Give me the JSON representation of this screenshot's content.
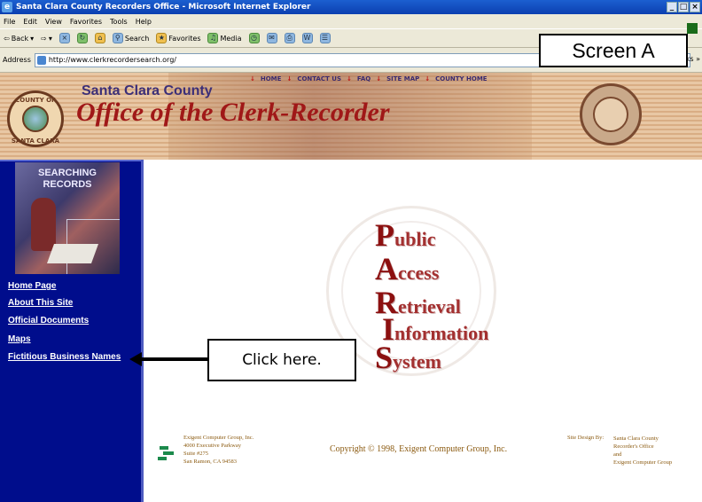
{
  "window": {
    "title": "Santa Clara County Recorders Office - Microsoft Internet Explorer",
    "controls": [
      "_",
      "□",
      "×"
    ]
  },
  "menubar": [
    "File",
    "Edit",
    "View",
    "Favorites",
    "Tools",
    "Help"
  ],
  "toolbar": {
    "back": "Back",
    "search": "Search",
    "favorites": "Favorites",
    "media": "Media"
  },
  "addressbar": {
    "label": "Address",
    "url": "http://www.clerkrecordersearch.org/",
    "links_stub": "ks »"
  },
  "annotations": {
    "screen_label": "Screen A",
    "click_here": "Click here."
  },
  "banner": {
    "county": "Santa Clara County",
    "office": "Office of the Clerk-Recorder",
    "seal_top": "COUNTY OF",
    "seal_bottom": "SANTA CLARA",
    "topnav": [
      "HOME",
      "CONTACT US",
      "FAQ",
      "SITE MAP",
      "COUNTY HOME"
    ]
  },
  "sidebar": {
    "image_caption_1": "SEARCHING",
    "image_caption_2": "RECORDS",
    "links": [
      "Home Page",
      "About This Site",
      "Official Documents",
      "Maps",
      "Fictitious Business Names"
    ]
  },
  "paris": [
    {
      "initial": "P",
      "rest": "ublic"
    },
    {
      "initial": "A",
      "rest": "ccess"
    },
    {
      "initial": "R",
      "rest": "etrieval"
    },
    {
      "initial": "I",
      "rest": "nformation"
    },
    {
      "initial": "S",
      "rest": "ystem"
    }
  ],
  "footer": {
    "address_lines": [
      "Exigent Computer Group, Inc.",
      "4000 Executive Parkway",
      "Suite #275",
      "San Ramon, CA 94583"
    ],
    "copyright": "Copyright © 1998, Exigent Computer Group, Inc.",
    "design_label": "Site Design By:",
    "design_credit": [
      "Santa Clara County",
      "Recorder's Office",
      "and",
      "Exigent Computer Group"
    ]
  }
}
